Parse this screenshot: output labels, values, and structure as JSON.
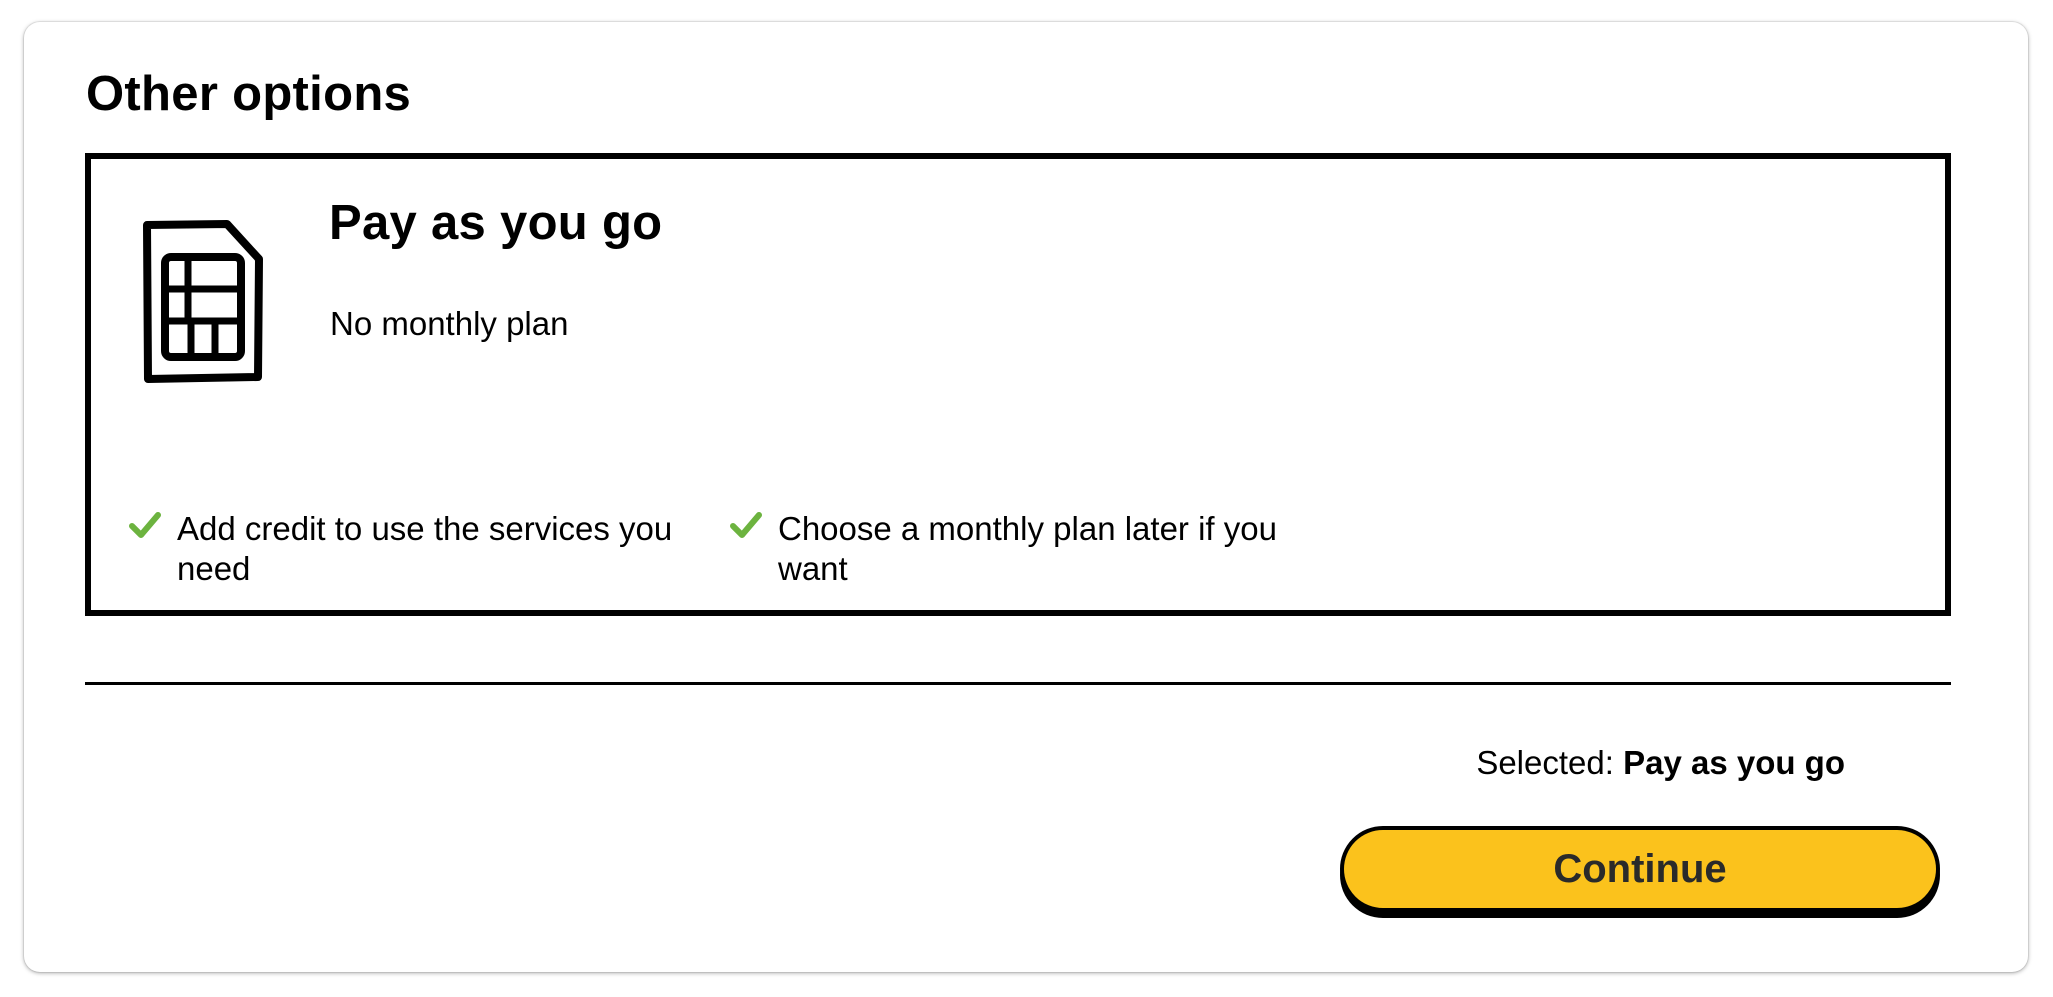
{
  "section": {
    "title": "Other options"
  },
  "plan": {
    "icon": "sim-card-icon",
    "name": "Pay as you go",
    "subtitle": "No monthly plan",
    "features": [
      {
        "icon": "checkmark-icon",
        "text": "Add credit to use the services you need"
      },
      {
        "icon": "checkmark-icon",
        "text": "Choose a monthly plan later if you want"
      }
    ]
  },
  "footer": {
    "selected_label": "Selected:",
    "selected_value": "Pay as you go",
    "continue_label": "Continue"
  },
  "colors": {
    "accent": "#fbc21c",
    "check": "#6cb33f",
    "border": "#000000"
  }
}
